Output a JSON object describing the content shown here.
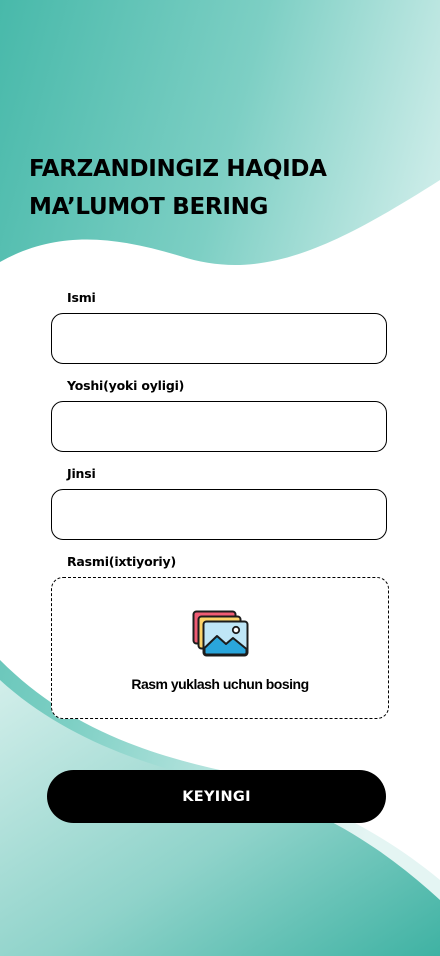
{
  "title": {
    "line1": "FARZANDINGIZ HAQIDA",
    "line2": "MA’LUMOT BERING"
  },
  "form": {
    "name_label": "Ismi",
    "name_value": "",
    "age_label": "Yoshi(yoki oyligi)",
    "age_value": "",
    "gender_label": "Jinsi",
    "gender_value": "",
    "photo_label": "Rasmi(ixtiyoriy)",
    "upload_text": "Rasm yuklash uchun bosing",
    "upload_icon": "image-gallery-icon"
  },
  "next_button_label": "KEYINGI",
  "colors": {
    "teal": "#4dbcae",
    "teal_light": "#bfe7e2",
    "button_bg": "#000000",
    "button_text": "#ffffff"
  }
}
